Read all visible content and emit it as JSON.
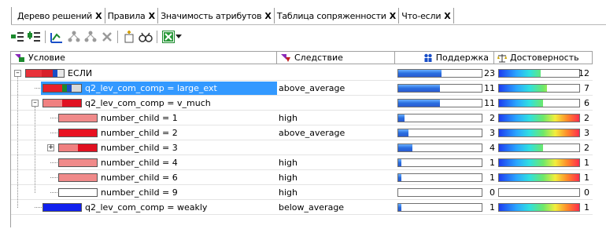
{
  "tabs": [
    {
      "label": "Дерево решений",
      "close": "X",
      "active": true
    },
    {
      "label": "Правила",
      "close": "X",
      "active": false
    },
    {
      "label": "Значимость атрибутов",
      "close": "X",
      "active": false
    },
    {
      "label": "Таблица сопряженности",
      "close": "X",
      "active": false
    },
    {
      "label": "Что-если",
      "close": "X",
      "active": false
    }
  ],
  "toolbar": {
    "icons": [
      "collapse-all-icon",
      "expand-all-icon",
      "show-chart-icon",
      "tree-icon",
      "tree-icon-2",
      "delete-icon",
      "new-node-icon",
      "find-icon",
      "excel-export-icon",
      "dropdown-arrow-icon"
    ],
    "colors": {
      "green": "#1c8a2e",
      "blue": "#1a4fc8",
      "red": "#c02020"
    }
  },
  "columns": {
    "condition": "Условие",
    "consequence": "Следствие",
    "support": "Поддержка",
    "confidence": "Достоверность"
  },
  "rows": [
    {
      "condition": "ЕСЛИ",
      "consequence": "",
      "support": "23",
      "support_frac": 0.52,
      "confidence": "12",
      "confidence_frac": 0.52,
      "level": 0,
      "toggle": "−",
      "swatch": "multi"
    },
    {
      "condition": "q2_lev_com_comp = large_ext",
      "consequence": "above_average",
      "support": "11",
      "support_frac": 0.5,
      "confidence": "7",
      "confidence_frac": 0.6,
      "level": 1,
      "toggle": "",
      "swatch": "multi2",
      "selected": true
    },
    {
      "condition": "q2_lev_com_comp = v_much",
      "consequence": "",
      "support": "11",
      "support_frac": 0.5,
      "confidence": "6",
      "confidence_frac": 0.55,
      "level": 1,
      "toggle": "−",
      "swatch": "red-half"
    },
    {
      "condition": "number_child = 1",
      "consequence": "high",
      "support": "2",
      "support_frac": 0.08,
      "confidence": "2",
      "confidence_frac": 1.0,
      "level": 2,
      "toggle": "",
      "swatch": "pink"
    },
    {
      "condition": "number_child = 2",
      "consequence": "above_average",
      "support": "3",
      "support_frac": 0.12,
      "confidence": "3",
      "confidence_frac": 1.0,
      "level": 2,
      "toggle": "",
      "swatch": "red"
    },
    {
      "condition": "number_child = 3",
      "consequence": "",
      "support": "4",
      "support_frac": 0.17,
      "confidence": "2",
      "confidence_frac": 0.55,
      "level": 2,
      "toggle": "+",
      "swatch": "red-half"
    },
    {
      "condition": "number_child = 4",
      "consequence": "high",
      "support": "1",
      "support_frac": 0.04,
      "confidence": "1",
      "confidence_frac": 1.0,
      "level": 2,
      "toggle": "",
      "swatch": "pink"
    },
    {
      "condition": "number_child = 6",
      "consequence": "high",
      "support": "1",
      "support_frac": 0.04,
      "confidence": "1",
      "confidence_frac": 1.0,
      "level": 2,
      "toggle": "",
      "swatch": "pink"
    },
    {
      "condition": "number_child = 9",
      "consequence": "high",
      "support": "0",
      "support_frac": 0.0,
      "confidence": "0",
      "confidence_frac": 0.0,
      "level": 2,
      "toggle": "",
      "swatch": "white"
    },
    {
      "condition": "q2_lev_com_comp = weakly",
      "consequence": "below_average",
      "support": "1",
      "support_frac": 0.04,
      "confidence": "1",
      "confidence_frac": 1.0,
      "level": 1,
      "toggle": "",
      "swatch": "blue"
    }
  ]
}
